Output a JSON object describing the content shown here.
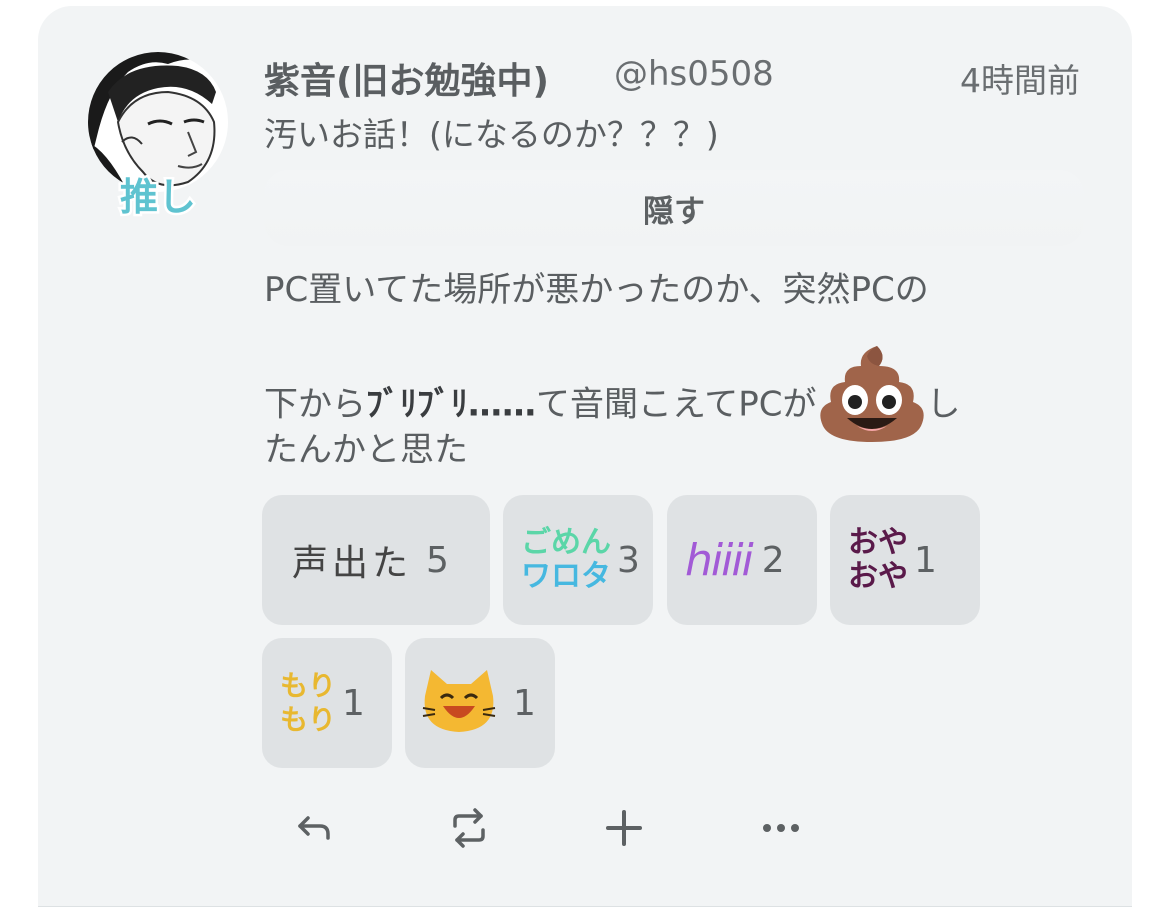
{
  "post": {
    "display_name": "紫音(旧お勉強中)",
    "handle": "@hs0508",
    "time": "4時間前",
    "cw_text": "汚いお話！(になるのか？？？)",
    "hide_label": "隠す",
    "body_line1": "PC置いてた場所が悪かったのか、突然PCの",
    "body_line2_a": "下から",
    "body_line2_b": "ﾌﾞﾘﾌﾞﾘ……",
    "body_line2_c": "て音聞こえてPCが",
    "body_line2_d": "し",
    "body_line3": "たんかと思た",
    "avatar_badge": "推し",
    "emoji_icon": "poop-emoji"
  },
  "reactions": [
    {
      "label": "声出た",
      "count": "5",
      "kind": "handwritten-text"
    },
    {
      "label": "ごめん ワロタ",
      "line1": "ごめん",
      "line2": "ワロタ",
      "count": "3",
      "kind": "text-emoji"
    },
    {
      "label": "hiiii",
      "count": "2",
      "kind": "text-emoji"
    },
    {
      "label": "おや おや",
      "line1": "おや",
      "line2": "おや",
      "count": "1",
      "kind": "text-emoji"
    },
    {
      "label": "もり もり",
      "line1": "もり",
      "line2": "もり",
      "count": "1",
      "kind": "text-emoji"
    },
    {
      "label": "laughing cat",
      "count": "1",
      "kind": "cat-emoji"
    }
  ],
  "actions": [
    "reply-icon",
    "renote-icon",
    "plus-icon",
    "more-icon"
  ],
  "colors": {
    "card_bg": "#f2f4f5",
    "reaction_bg": "#dfe2e4",
    "text": "#5a5e61"
  }
}
